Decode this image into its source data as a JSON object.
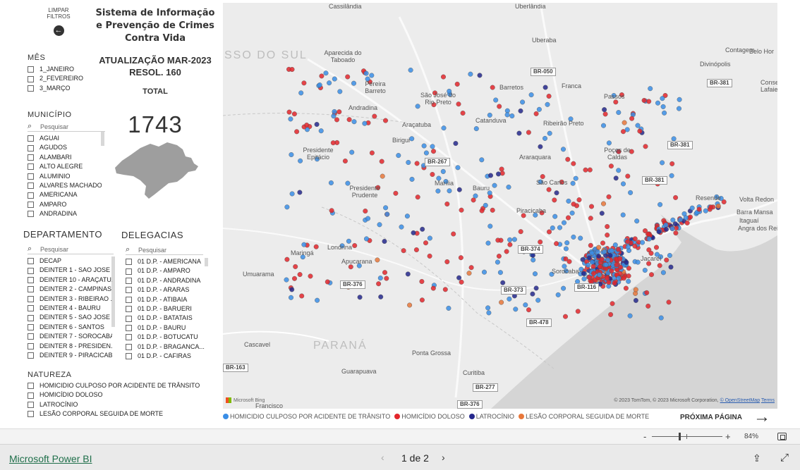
{
  "report": {
    "clear_filters_label": "LIMPAR\nFILTROS",
    "title": "Sistema de Informação e Prevenção de Crimes Contra Vida",
    "update_line1": "ATUALIZAÇÃO MAR-2023",
    "update_line2": "RESOL. 160",
    "total_label": "TOTAL",
    "total_value": "1743"
  },
  "slicers": {
    "mes": {
      "title": "MÊS",
      "items": [
        "1_JANEIRO",
        "2_FEVEREIRO",
        "3_MARÇO"
      ]
    },
    "municipio": {
      "title": "MUNICÍPIO",
      "placeholder": "Pesquisar",
      "items": [
        "AGUAI",
        "AGUDOS",
        "ALAMBARI",
        "ALTO ALEGRE",
        "ALUMINIO",
        "ALVARES MACHADO",
        "AMERICANA",
        "AMPARO",
        "ANDRADINA"
      ]
    },
    "departamento": {
      "title": "DEPARTAMENTO",
      "placeholder": "Pesquisar",
      "items": [
        "DECAP",
        "DEINTER 1 - SAO JOSE ...",
        "DEINTER 10 - ARAÇATU...",
        "DEINTER 2 - CAMPINAS",
        "DEINTER 3 - RIBEIRAO ...",
        "DEINTER 4 - BAURU",
        "DEINTER 5 - SAO JOSE ...",
        "DEINTER 6 - SANTOS",
        "DEINTER 7 - SOROCABA",
        "DEINTER 8 - PRESIDEN...",
        "DEINTER 9 - PIRACICABA"
      ]
    },
    "delegacias": {
      "title": "DELEGACIAS",
      "placeholder": "Pesquisar",
      "items": [
        "01 D.P. - AMERICANA",
        "01 D.P. - AMPARO",
        "01 D.P. - ANDRADINA",
        "01 D.P. - ARARAS",
        "01 D.P. - ATIBAIA",
        "01 D.P. - BARUERI",
        "01 D.P. - BATATAIS",
        "01 D.P. - BAURU",
        "01 D.P. - BOTUCATU",
        "01 D.P. - BRAGANCA...",
        "01 D.P. - CAFIRAS"
      ]
    },
    "natureza": {
      "title": "NATUREZA",
      "items": [
        "HOMICIDIO CULPOSO POR ACIDENTE DE TRÂNSITO",
        "HOMICÍDIO DOLOSO",
        "LATROCÍNIO",
        "LESÃO CORPORAL SEGUIDA DE MORTE"
      ]
    }
  },
  "map": {
    "place_labels": [
      "Cassilândia",
      "Uberlândia",
      "Uberaba",
      "Contagem",
      "Belo Hor",
      "Aparecida do Taboado",
      "Divinópolis",
      "Pereira Barreto",
      "São José do Rio Preto",
      "Barretos",
      "Franca",
      "Passos",
      "Conselheiro Lafaiet",
      "Andradina",
      "Catanduva",
      "Ribeirão Preto",
      "Araçatuba",
      "Birigui",
      "Presidente Epitácio",
      "Araraquara",
      "Poços de Caldas",
      "Presidente Prudente",
      "Marília",
      "Bauru",
      "São Carlos",
      "Resende",
      "Volta Redon",
      "Barra Mansa",
      "Piracicaba",
      "Itaguaí",
      "Angra dos Reis",
      "Maringá",
      "Londrina",
      "Apucarana",
      "Umuarama",
      "Sorocaba",
      "Jacareí",
      "Cascavel",
      "Ponta Grossa",
      "Guarapuava",
      "Curitiba",
      "Francisco"
    ],
    "state_labels": [
      "SSO DO SUL",
      "PARANÁ"
    ],
    "road_shields": [
      "BR-050",
      "BR-381",
      "BR-267",
      "BR-381",
      "BR-381",
      "BR-374",
      "BR-376",
      "BR-373",
      "BR-116",
      "BR-478",
      "BR-163",
      "BR-277",
      "BR-376"
    ],
    "attribution": "© 2023 TomTom, © 2023 Microsoft Corporation,",
    "attribution_osm": "© OpenStreetMap",
    "attribution_terms": "Terms",
    "bing_label": "Microsoft Bing"
  },
  "legend": [
    {
      "label": "HOMICIDIO CULPOSO POR ACIDENTE DE TRÂNSITO",
      "color": "#3a8ee6"
    },
    {
      "label": "HOMICÍDIO DOLOSO",
      "color": "#e3262c"
    },
    {
      "label": "LATROCÍNIO",
      "color": "#25288c"
    },
    {
      "label": "LESÃO CORPORAL SEGUIDA DE MORTE",
      "color": "#e8773a"
    }
  ],
  "next_page_label": "PRÓXIMA PÁGINA",
  "zoom": {
    "percent": "84%"
  },
  "footer": {
    "brand_link": "Microsoft Power BI",
    "page_indicator": "1 de 2"
  }
}
